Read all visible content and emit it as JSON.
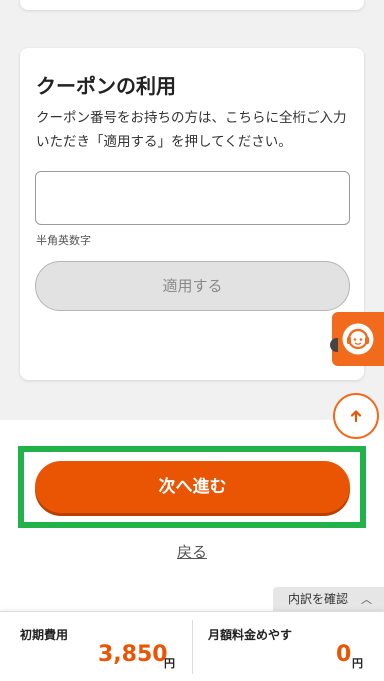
{
  "coupon": {
    "title": "クーポンの利用",
    "description": "クーポン番号をお持ちの方は、こちらに全桁ご入力いただき「適用する」を押してください。",
    "input_value": "",
    "input_hint": "半角英数字",
    "apply_label": "適用する"
  },
  "actions": {
    "next_label": "次へ進む",
    "back_label": "戻る"
  },
  "footer": {
    "breakdown_label": "内訳を確認",
    "initial_fee_label": "初期費用",
    "initial_fee_value": "3,850",
    "initial_fee_unit": "円",
    "monthly_fee_label": "月額料金めやす",
    "monthly_fee_value": "0",
    "monthly_fee_unit": "円"
  },
  "icons": {
    "support": "operator-headset-icon",
    "scroll_top": "arrow-up-icon",
    "breakdown": "chevron-up-icon"
  },
  "colors": {
    "accent": "#ea5504",
    "highlight_frame": "#21b24a",
    "disabled_button": "#e2e2e2"
  }
}
